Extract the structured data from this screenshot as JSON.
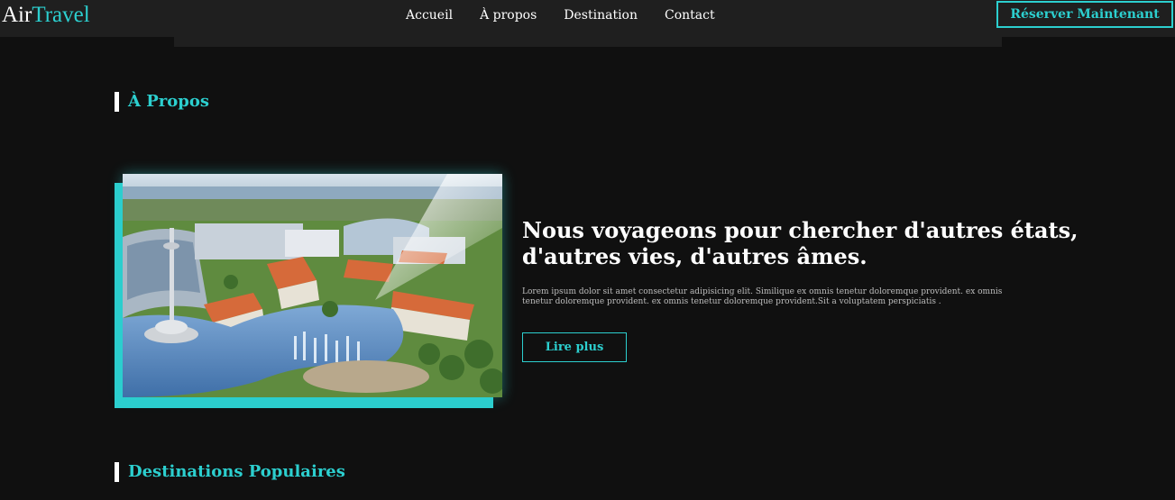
{
  "brand": {
    "part1": "Air",
    "part2": "Travel"
  },
  "nav": {
    "links": [
      "Accueil",
      "À propos",
      "Destination",
      "Contact"
    ],
    "cta_label": "Réserver Maintenant"
  },
  "about": {
    "heading": "À Propos",
    "title": "Nous voyageons pour chercher d'autres états, d'autres vies, d'autres âmes.",
    "description": "Lorem ipsum dolor sit amet consectetur adipisicing elit. Similique ex omnis tenetur doloremque provident. ex omnis tenetur doloremque provident. ex omnis tenetur doloremque provident.Sit a voluptatem perspiciatis .",
    "button_label": "Lire plus"
  },
  "destinations": {
    "heading": "Destinations Populaires"
  },
  "colors": {
    "accent": "#2ccfcf",
    "background": "#101010",
    "nav_background": "#1f1f1f"
  }
}
